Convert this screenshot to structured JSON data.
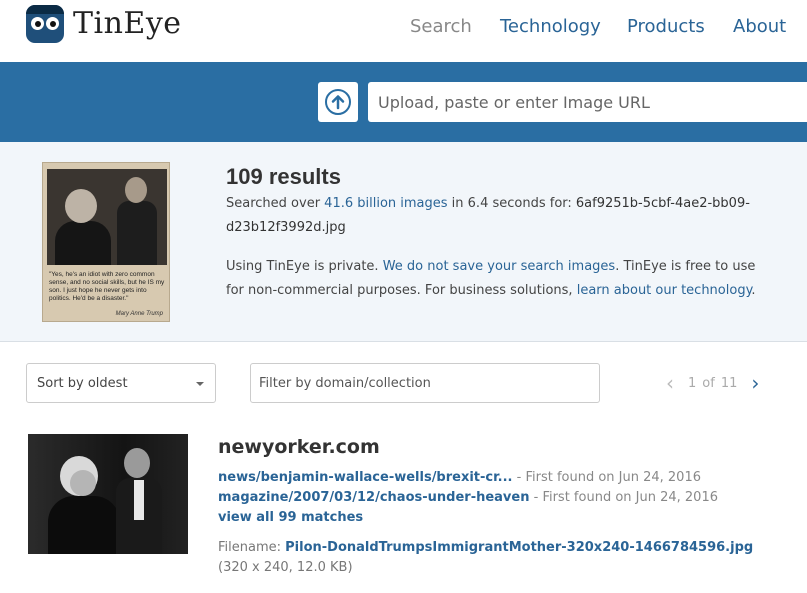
{
  "brand": {
    "name": "TinEye"
  },
  "nav": {
    "search": "Search",
    "technology": "Technology",
    "products": "Products",
    "about": "About"
  },
  "search": {
    "upload_icon": "upload-arrow-icon",
    "placeholder": "Upload, paste or enter Image URL"
  },
  "summary": {
    "results_count": "109 results",
    "searched_prefix": "Searched over ",
    "images_count": "41.6 billion images",
    "searched_middle": " in 6.4 seconds for: ",
    "filename": "6af9251b-5cbf-4ae2-bb09-d23b12f3992d.jpg",
    "privacy_prefix": "Using TinEye is private. ",
    "privacy_link": "We do not save your search images",
    "privacy_middle": ". TinEye is free to use for non-commercial purposes. For business solutions, ",
    "business_link": "learn about our technology",
    "privacy_suffix": "."
  },
  "query_image": {
    "caption": "\"Yes, he's an idiot with zero common sense, and no social skills, but he IS my son. I just hope he never gets into politics. He'd be a disaster.\"",
    "signature": "Mary Anne Trump"
  },
  "controls": {
    "sort_label": "Sort by oldest",
    "filter_placeholder": "Filter by domain/collection"
  },
  "pagination": {
    "current": "1",
    "of": "of",
    "total": "11"
  },
  "result": {
    "domain": "newyorker.com",
    "matches": [
      {
        "path": "news/benjamin-wallace-wells/brexit-cr...",
        "found": " - First found on Jun 24, 2016"
      },
      {
        "path": "magazine/2007/03/12/chaos-under-heaven",
        "found": " - First found on Jun 24, 2016"
      }
    ],
    "view_all": "view all 99 matches",
    "filename_label": "Filename: ",
    "filename": "Pilon-DonaldTrumpsImmigrantMother-320x240-1466784596.jpg",
    "dimensions": "(320 x 240, 12.0 KB)"
  },
  "colors": {
    "brand_blue": "#2a6ea3",
    "link": "#2a6496",
    "summary_bg": "#f2f6fa"
  }
}
